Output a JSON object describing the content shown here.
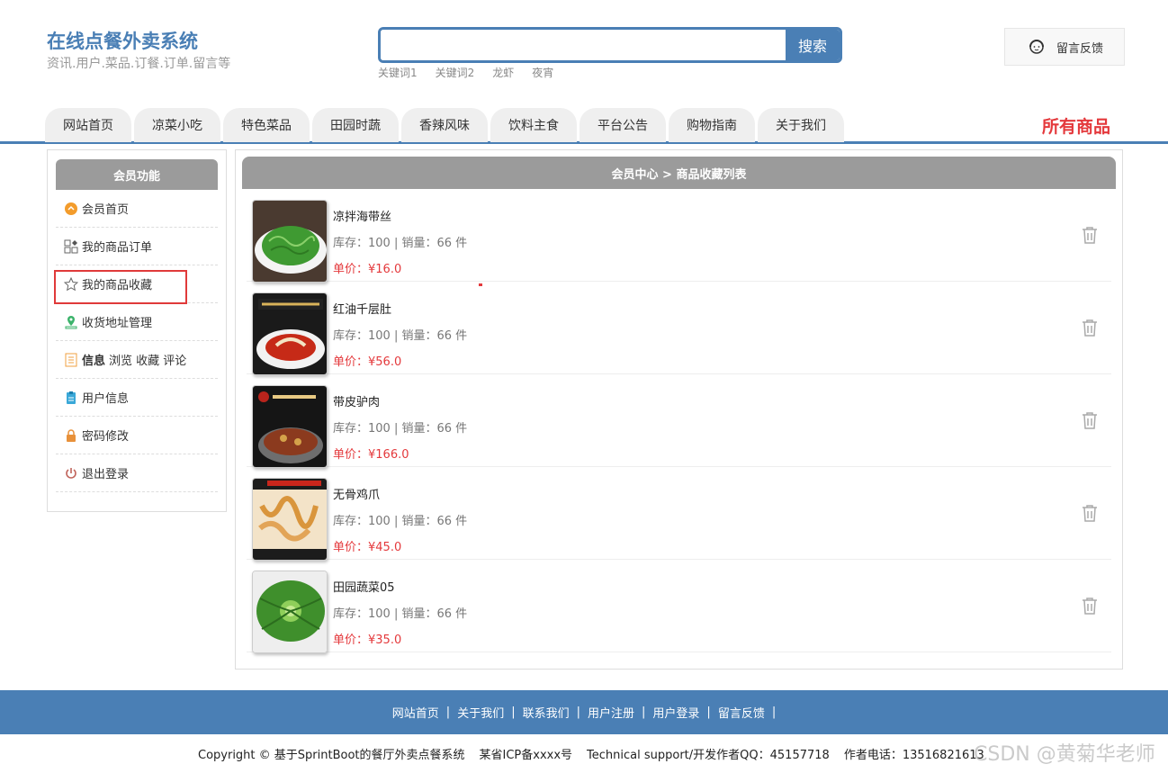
{
  "header": {
    "title": "在线点餐外卖系统",
    "subtitle": "资讯.用户.菜品.订餐.订单.留言等",
    "search": {
      "placeholder": "",
      "button": "搜索"
    },
    "keywords": [
      "关键词1",
      "关键词2",
      "龙虾",
      "夜宵"
    ],
    "feedback": "留言反馈"
  },
  "nav": {
    "items": [
      "网站首页",
      "凉菜小吃",
      "特色菜品",
      "田园时蔬",
      "香辣风味",
      "饮料主食",
      "平台公告",
      "购物指南",
      "关于我们"
    ],
    "all_products": "所有商品"
  },
  "sidebar": {
    "title": "会员功能",
    "items": [
      {
        "label": "会员首页",
        "icon": "member-home-icon"
      },
      {
        "label": "我的商品订单",
        "icon": "orders-icon"
      },
      {
        "label": "我的商品收藏",
        "icon": "star-icon"
      },
      {
        "label": "收货地址管理",
        "icon": "location-icon"
      },
      {
        "label": "信息",
        "extra": "浏览 收藏 评论",
        "icon": "info-list-icon"
      },
      {
        "label": "用户信息",
        "icon": "user-info-icon"
      },
      {
        "label": "密码修改",
        "icon": "lock-icon"
      },
      {
        "label": "退出登录",
        "icon": "power-icon"
      }
    ]
  },
  "main": {
    "title": "会员中心 > 商品收藏列表",
    "products": [
      {
        "name": "凉拌海带丝",
        "stock": "库存：100 | 销量：66 件",
        "price": "单价：¥16.0"
      },
      {
        "name": "红油千层肚",
        "stock": "库存：100 | 销量：66 件",
        "price": "单价：¥56.0"
      },
      {
        "name": "带皮驴肉",
        "stock": "库存：100 | 销量：66 件",
        "price": "单价：¥166.0"
      },
      {
        "name": "无骨鸡爪",
        "stock": "库存：100 | 销量：66 件",
        "price": "单价：¥45.0"
      },
      {
        "name": "田园蔬菜05",
        "stock": "库存：100 | 销量：66 件",
        "price": "单价：¥35.0"
      }
    ]
  },
  "footer": {
    "links": [
      "网站首页",
      "关于我们",
      "联系我们",
      "用户注册",
      "用户登录",
      "留言反馈"
    ],
    "copyright": "Copyright © 基于SprintBoot的餐厅外卖点餐系统",
    "icp": "某省ICP备xxxx号",
    "support": "Technical support/开发作者QQ：45157718",
    "phone": "作者电话：13516821613"
  },
  "watermark": "CSDN @黄菊华老师",
  "colors": {
    "primary": "#4a7fb5",
    "price": "#e4393c",
    "header_gray": "#9b9b9b"
  }
}
